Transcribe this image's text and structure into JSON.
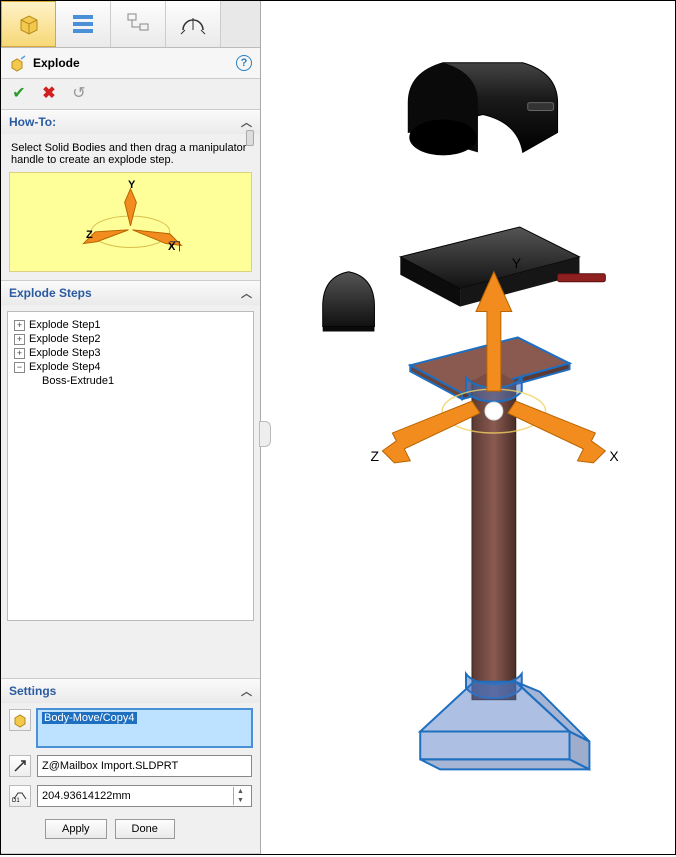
{
  "panel": {
    "title": "Explode",
    "help_tooltip": "?"
  },
  "howto": {
    "header": "How-To:",
    "text": "Select Solid Bodies and then drag a manipulator handle to create an explode step.",
    "axes": {
      "x": "X",
      "y": "Y",
      "z": "Z"
    }
  },
  "steps": {
    "header": "Explode Steps",
    "items": [
      {
        "label": "Explode Step1",
        "expanded": false,
        "children": []
      },
      {
        "label": "Explode Step2",
        "expanded": false,
        "children": []
      },
      {
        "label": "Explode Step3",
        "expanded": false,
        "children": []
      },
      {
        "label": "Explode Step4",
        "expanded": true,
        "children": [
          "Boss-Extrude1"
        ]
      }
    ]
  },
  "settings": {
    "header": "Settings",
    "body_field": "Body-Move/Copy4",
    "direction_field": "Z@Mailbox Import.SLDPRT",
    "distance_field": "204.93614122mm",
    "apply_label": "Apply",
    "done_label": "Done"
  },
  "viewport": {
    "axes": {
      "x": "X",
      "y": "Y",
      "z": "Z"
    }
  }
}
